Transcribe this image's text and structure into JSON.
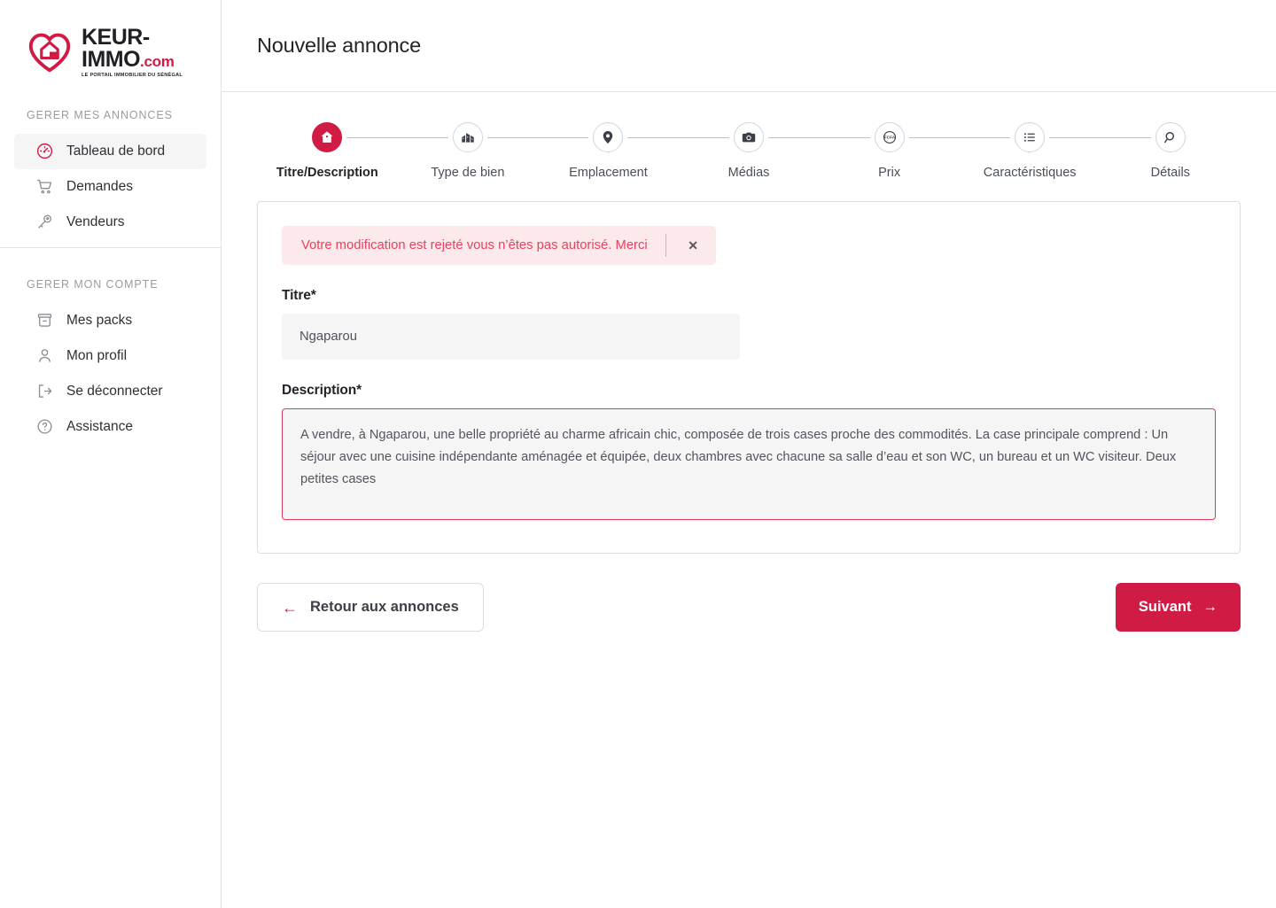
{
  "brand": {
    "logo_icon": "heart-house-icon",
    "name_line1": "KEUR-",
    "name_line2": "IMMO",
    "name_suffix": ".com",
    "tagline": "LE PORTAIL IMMOBILIER DU SÉNÉGAL",
    "accent_color": "#d01c45"
  },
  "sidebar": {
    "sections": [
      {
        "heading": "GERER MES ANNONCES",
        "items": [
          {
            "label": "Tableau de bord",
            "icon": "speedometer-icon",
            "active": true
          },
          {
            "label": "Demandes",
            "icon": "shopping-cart-icon",
            "active": false
          },
          {
            "label": "Vendeurs",
            "icon": "key-icon",
            "active": false
          }
        ]
      },
      {
        "heading": "GERER MON COMPTE",
        "items": [
          {
            "label": "Mes packs",
            "icon": "box-icon",
            "active": false
          },
          {
            "label": "Mon profil",
            "icon": "user-icon",
            "active": false
          },
          {
            "label": "Se déconnecter",
            "icon": "logout-icon",
            "active": false
          },
          {
            "label": "Assistance",
            "icon": "question-circle-icon",
            "active": false
          }
        ]
      }
    ]
  },
  "header": {
    "title": "Nouvelle annonce"
  },
  "stepper": {
    "steps": [
      {
        "label": "Titre/Description",
        "icon": "home-icon",
        "active": true
      },
      {
        "label": "Type de bien",
        "icon": "building-icon",
        "active": false
      },
      {
        "label": "Emplacement",
        "icon": "map-pin-icon",
        "active": false
      },
      {
        "label": "Médias",
        "icon": "camera-icon",
        "active": false
      },
      {
        "label": "Prix",
        "icon": "fcfa-icon",
        "active": false
      },
      {
        "label": "Caractéristiques",
        "icon": "list-icon",
        "active": false
      },
      {
        "label": "Détails",
        "icon": "search-icon",
        "active": false
      }
    ]
  },
  "form": {
    "alert": {
      "message": "Votre modification est rejeté vous n’êtes pas autorisé. Merci",
      "close_label": "✕",
      "background_color": "#fce9ec",
      "text_color": "#e8415f"
    },
    "titre": {
      "label": "Titre*",
      "value": "Ngaparou",
      "placeholder": "Titre"
    },
    "description": {
      "label": "Description*",
      "value": "A vendre, à Ngaparou, une belle propriété au charme africain chic, composée de trois cases proche des commodités. La case principale comprend : Un séjour avec une cuisine indépendante aménagée et équipée, deux chambres avec chacune sa salle d’eau et son WC, un bureau et un WC visiteur. Deux petites cases",
      "placeholder": "Description",
      "error": true,
      "border_color": "#e0395c"
    }
  },
  "actions": {
    "back_label": "Retour aux annonces",
    "back_arrow": "←",
    "next_label": "Suivant",
    "next_arrow": "→"
  }
}
